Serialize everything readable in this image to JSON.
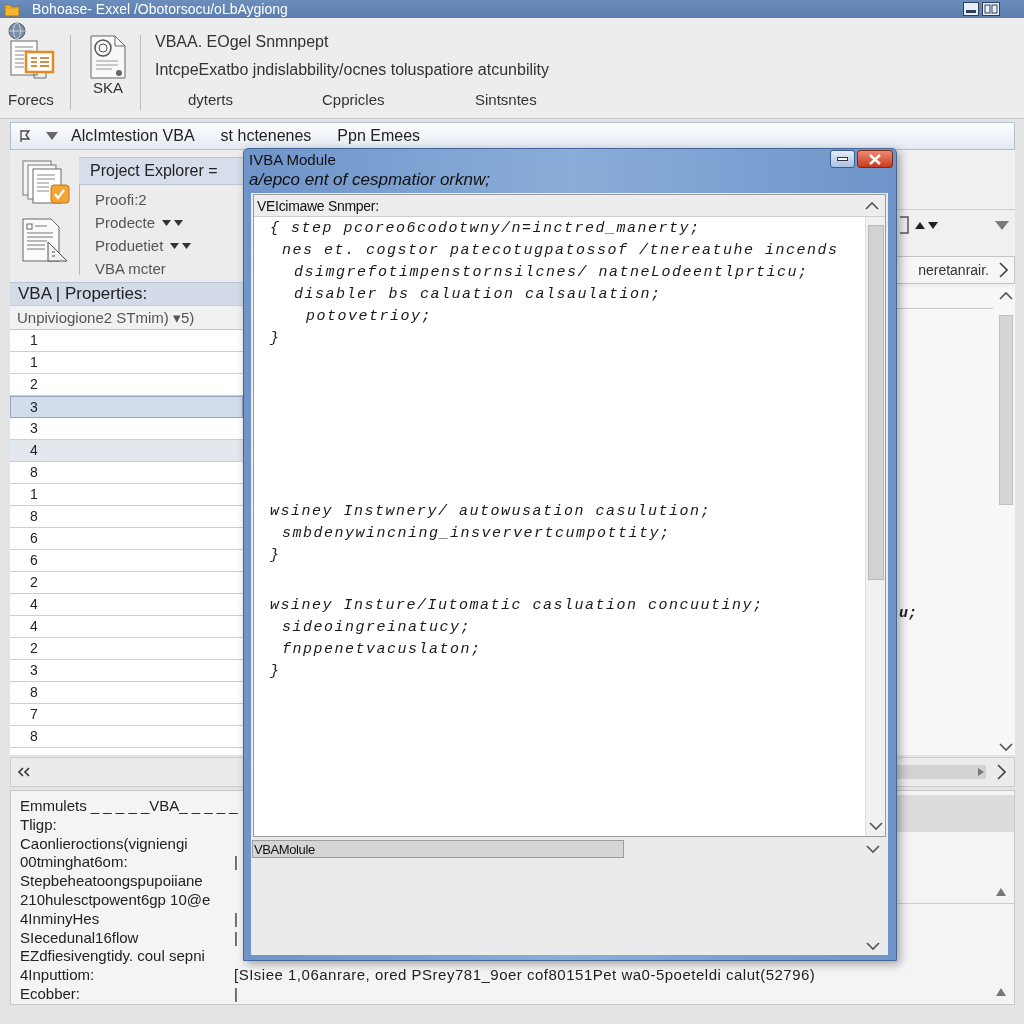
{
  "window": {
    "title": "Bohoase- Exxel /Obotorsocu/oLbAygiong"
  },
  "ribbon": {
    "buttons": [
      {
        "label": "Forecs"
      },
      {
        "label": "SKA"
      }
    ],
    "heading": "VBAA. EOgel Snmnpept",
    "description": "IntcpeExatbo jndislabbility/ocnes toluspatiore atcunbility",
    "group_labels": [
      "dyterts",
      "Cppricles",
      "Sintsntes"
    ]
  },
  "toolbar": {
    "items": [
      "AlcImtestion VBA",
      "st hctenenes",
      "Ppn Emees"
    ]
  },
  "project_explorer": {
    "title": "Project Explorer =",
    "items": [
      {
        "label": "Proofi:2",
        "dropdown": false
      },
      {
        "label": "Prodecte",
        "dropdown": true
      },
      {
        "label": "Produetiet",
        "dropdown": true
      },
      {
        "label": "VBA mcter",
        "dropdown": false
      }
    ]
  },
  "vba_list": {
    "title": "VBA | Properties:",
    "subheader": "Unpiviogione2 STmim) ▾5)",
    "rows": [
      {
        "value": "1",
        "selected": false,
        "hovered": false
      },
      {
        "value": "1",
        "selected": false,
        "hovered": false
      },
      {
        "value": "2",
        "selected": false,
        "hovered": false
      },
      {
        "value": "3",
        "selected": true,
        "hovered": false
      },
      {
        "value": "3",
        "selected": false,
        "hovered": false
      },
      {
        "value": "4",
        "selected": false,
        "hovered": true
      },
      {
        "value": "8",
        "selected": false,
        "hovered": false
      },
      {
        "value": "1",
        "selected": false,
        "hovered": false
      },
      {
        "value": "8",
        "selected": false,
        "hovered": false
      },
      {
        "value": "6",
        "selected": false,
        "hovered": false
      },
      {
        "value": "6",
        "selected": false,
        "hovered": false
      },
      {
        "value": "2",
        "selected": false,
        "hovered": false
      },
      {
        "value": "4",
        "selected": false,
        "hovered": false
      },
      {
        "value": "4",
        "selected": false,
        "hovered": false
      },
      {
        "value": "2",
        "selected": false,
        "hovered": false
      },
      {
        "value": "3",
        "selected": false,
        "hovered": false
      },
      {
        "value": "8",
        "selected": false,
        "hovered": false
      },
      {
        "value": "7",
        "selected": false,
        "hovered": false
      },
      {
        "value": "8",
        "selected": false,
        "hovered": false
      }
    ]
  },
  "right_pane": {
    "header": "neretanrair.",
    "code_fragment": "u;"
  },
  "properties": {
    "title": "Emmulets _ _ _ _ _VBA_ _ _ _ _",
    "rows": [
      {
        "label": "Tligp:"
      },
      {
        "label": "Caonlieroctions(vigniengi"
      },
      {
        "label": "00tminghat6om:",
        "value": "|"
      },
      {
        "label": "Stepbeheatoongspupoiiane"
      },
      {
        "label": "210hulesctpowent6gp 10@e"
      },
      {
        "label": "4InminyHes",
        "value": "|"
      },
      {
        "label": "SIecedunal16flow",
        "value": "|"
      },
      {
        "label": "EZdfiesivengtidy. coul sepni"
      },
      {
        "label": "4Inputtiom:",
        "value": "[SIsiee 1,06anrare, ored PSrey781_9oer cof80151Pet wa0-5poeteldi calut(52796)"
      },
      {
        "label": "Ecobber:",
        "value": "|"
      }
    ]
  },
  "dialog": {
    "title": "IVBA Module",
    "subtitle": "a/epco ent of cespmatior orknw;",
    "code_header": "VEIcimawe Snmper:",
    "code_blocks": [
      {
        "lines": [
          {
            "text": "{ step pcoreo6codotwny/n=inctred_manerty;",
            "children": [
              {
                "text": "nes et. cogstor patecotugpatossof /tnereatuhe incends",
                "children": [
                  {
                    "text": "dsimgrefotimpenstornsilcnes/ natneLodeentlprticu;"
                  },
                  {
                    "text": "disabler bs caluation calsaulation;",
                    "children": [
                      {
                        "text": "potovetrioy;"
                      }
                    ]
                  }
                ]
              }
            ]
          },
          {
            "text": "}"
          }
        ]
      },
      {
        "lines": [
          {
            "text": "wsiney Instwnery/ autowusation casulution;",
            "children": [
              {
                "text": "smbdenywincning_insververtcumpottity;"
              }
            ]
          },
          {
            "text": "}"
          }
        ]
      },
      {
        "lines": [
          {
            "text": "wsiney Insture/Iutomatic casluation concuutiny;",
            "children": [
              {
                "text": "sideoingreinatucy;"
              },
              {
                "text": "fnppenetvacuslaton;"
              }
            ]
          },
          {
            "text": "}"
          }
        ]
      }
    ],
    "module_field": {
      "value": "VBAMolule"
    }
  }
}
